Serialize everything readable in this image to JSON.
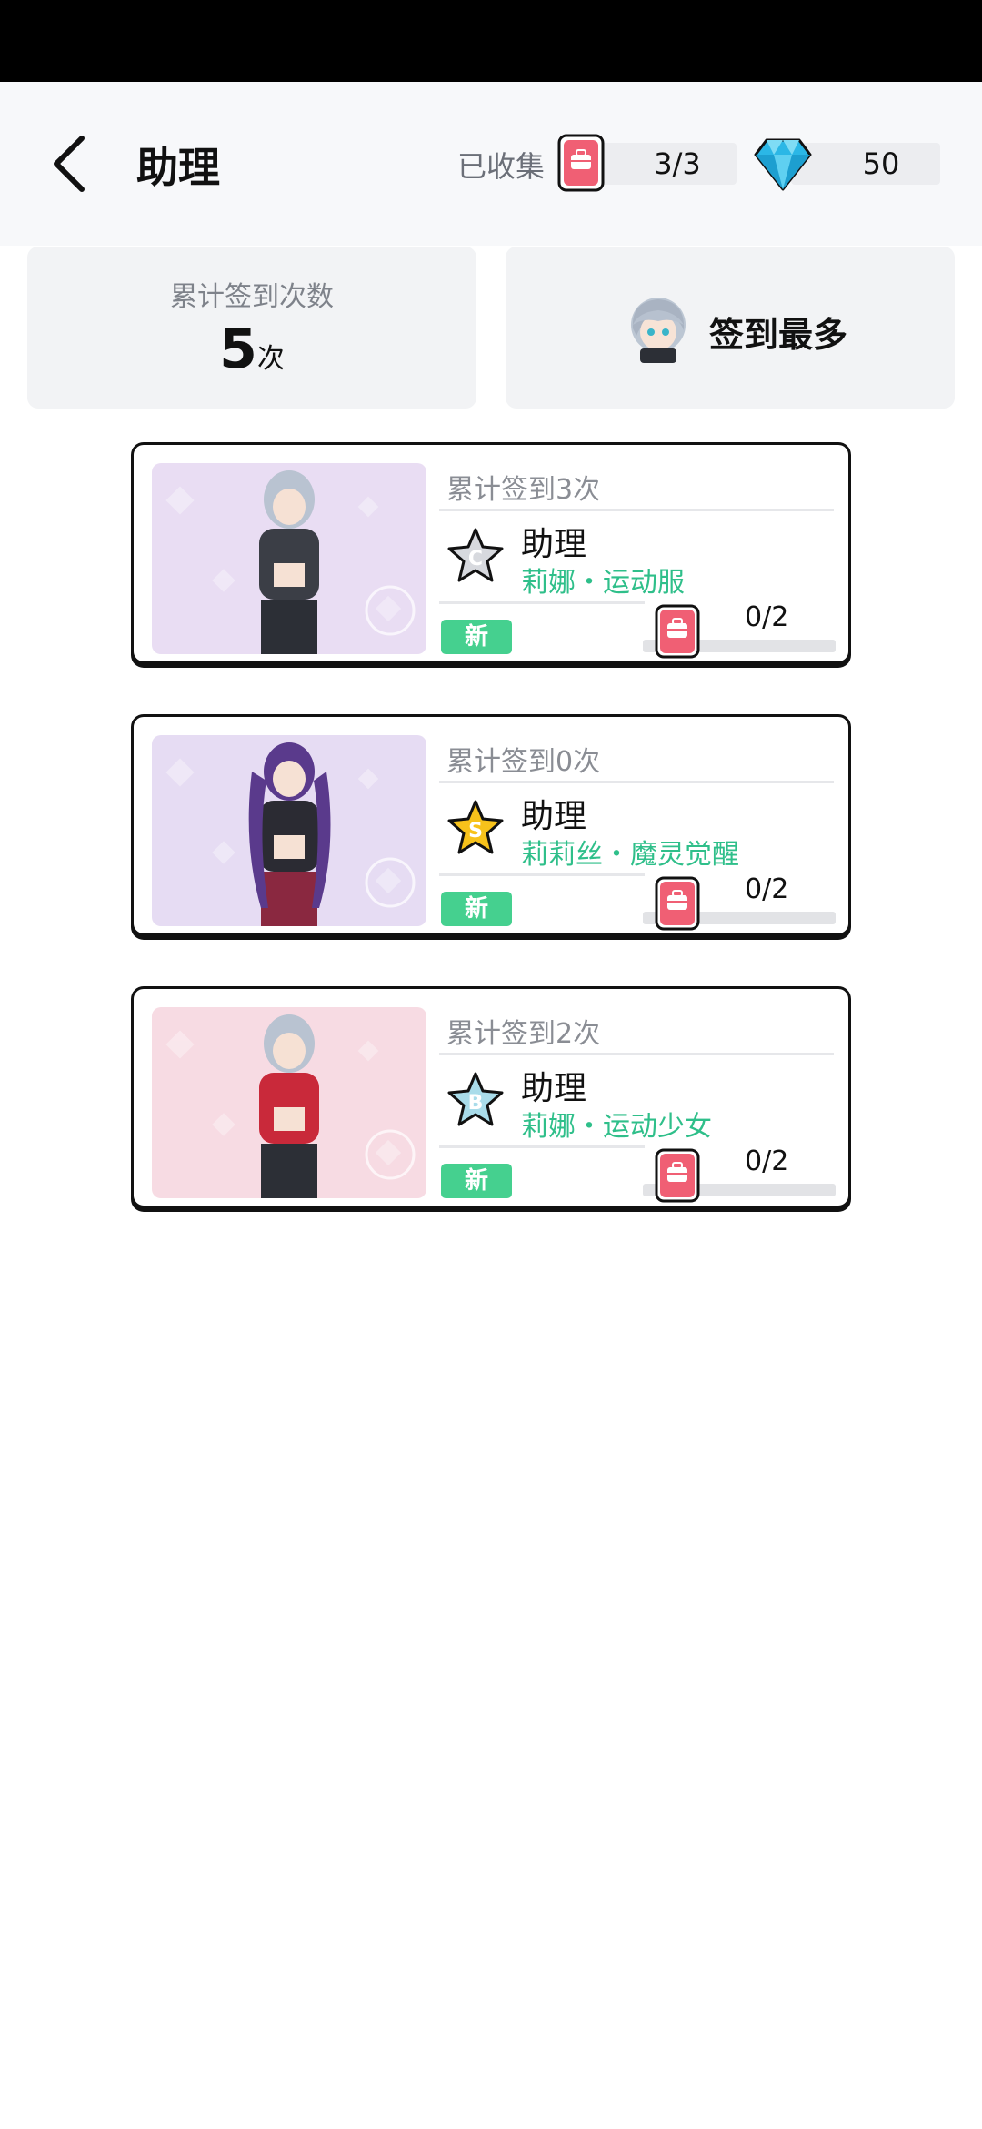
{
  "header": {
    "title": "助理",
    "collected_label": "已收集",
    "collected_value": "3/3",
    "gems_value": "50"
  },
  "stats": {
    "total_label": "累计签到次数",
    "total_number": "5",
    "total_unit": "次",
    "most_label": "签到最多"
  },
  "cards": [
    {
      "signin": "累计签到3次",
      "grade": "C",
      "title": "助理",
      "subtitle": "莉娜・运动服",
      "badge": "新",
      "progress": "0/2",
      "progress_fraction": 0,
      "bg": "#e9ddf3"
    },
    {
      "signin": "累计签到0次",
      "grade": "S",
      "title": "助理",
      "subtitle": "莉莉丝・魔灵觉醒",
      "badge": "新",
      "progress": "0/2",
      "progress_fraction": 0,
      "bg": "#e6dcf3"
    },
    {
      "signin": "累计签到2次",
      "grade": "B",
      "title": "助理",
      "subtitle": "莉娜・运动少女",
      "badge": "新",
      "progress": "0/2",
      "progress_fraction": 0,
      "bg": "#f7dbe3"
    }
  ],
  "colors": {
    "accent_green": "#2fbf8a",
    "badge_green": "#45d08f",
    "bag_red": "#f05f74"
  }
}
